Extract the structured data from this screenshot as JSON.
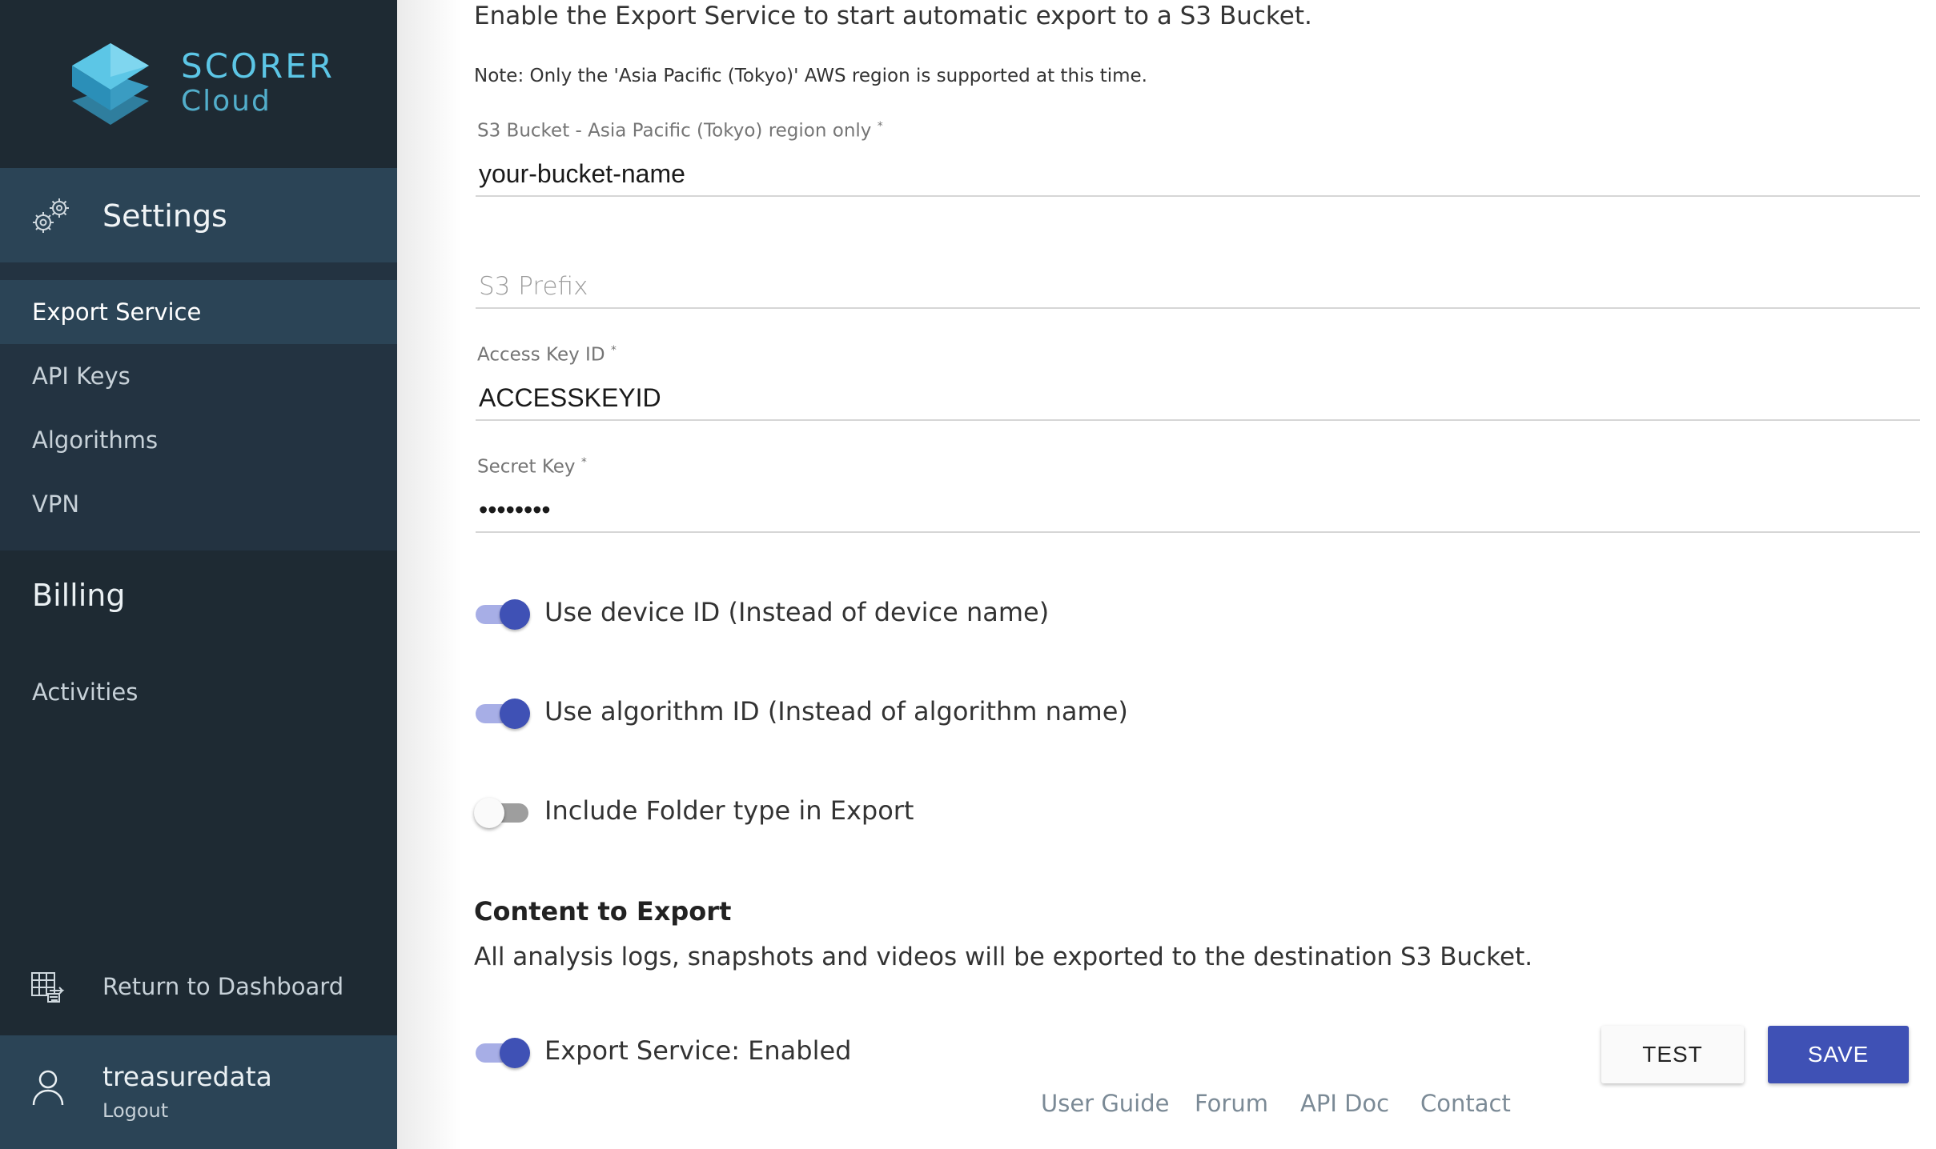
{
  "brand": {
    "name": "SCORER",
    "sub": "Cloud",
    "accent_color": "#5cc6e6"
  },
  "sidebar": {
    "settings_label": "Settings",
    "items": [
      {
        "label": "Export Service",
        "active": true
      },
      {
        "label": "API Keys",
        "active": false
      },
      {
        "label": "Algorithms",
        "active": false
      },
      {
        "label": "VPN",
        "active": false
      }
    ],
    "billing_label": "Billing",
    "activities_label": "Activities",
    "return_label": "Return to Dashboard",
    "user": {
      "name": "treasuredata",
      "logout_label": "Logout"
    },
    "colors": {
      "background": "#1e2a33",
      "active": "#2b4456"
    }
  },
  "main": {
    "intro": "Enable the Export Service to start automatic export to a S3 Bucket.",
    "note": "Note: Only the 'Asia Pacific (Tokyo)' AWS region is supported at this time.",
    "fields": {
      "bucket": {
        "label": "S3 Bucket - Asia Pacific (Tokyo) region only",
        "required": "*",
        "value": "your-bucket-name"
      },
      "prefix": {
        "placeholder": "S3 Prefix",
        "value": ""
      },
      "access_key": {
        "label": "Access Key ID",
        "required": "*",
        "value": "ACCESSKEYID"
      },
      "secret_key": {
        "label": "Secret Key",
        "required": "*",
        "value": "••••••••"
      }
    },
    "toggles": [
      {
        "label": "Use device ID (Instead of device name)",
        "on": true
      },
      {
        "label": "Use algorithm ID (Instead of algorithm name)",
        "on": true
      },
      {
        "label": "Include Folder type in Export",
        "on": false
      }
    ],
    "content_title": "Content to Export",
    "content_desc": "All analysis logs, snapshots and videos will be exported to the destination S3 Bucket.",
    "export_toggle": {
      "label": "Export Service: Enabled",
      "on": true
    },
    "buttons": {
      "test": "TEST",
      "save": "SAVE"
    },
    "accent_color": "#3f51b5"
  },
  "footer": {
    "links": [
      "User Guide",
      "Forum",
      "API Doc",
      "Contact"
    ]
  }
}
